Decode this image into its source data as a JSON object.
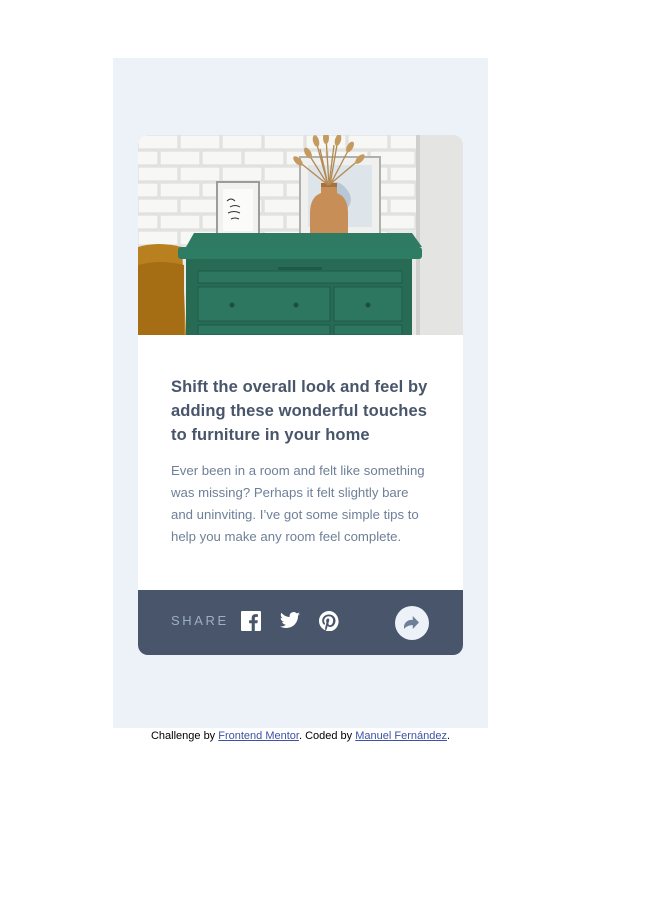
{
  "card": {
    "image_alt": "drawers",
    "title": "Shift the overall look and feel by adding these wonderful touches to furniture in your home",
    "description": "Ever been in a room and felt like something was missing? Perhaps it felt slightly bare and uninviting. I’ve got some simple tips to help you make any room feel complete."
  },
  "share": {
    "label": "SHARE",
    "icons": [
      "facebook-icon",
      "twitter-icon",
      "pinterest-icon",
      "share-icon"
    ]
  },
  "attribution": {
    "prefix": "Challenge by",
    "challenge_link": "Frontend Mentor",
    "middle": ". Coded by",
    "author_link": "Manuel Fernández",
    "suffix": "."
  },
  "colors": {
    "panel_bg": "#ecf2f8",
    "share_bar_bg": "#48556a",
    "title_text": "#48556a",
    "body_text": "#6e8098",
    "share_label": "#9eafc2",
    "link": "#3e52a3"
  }
}
